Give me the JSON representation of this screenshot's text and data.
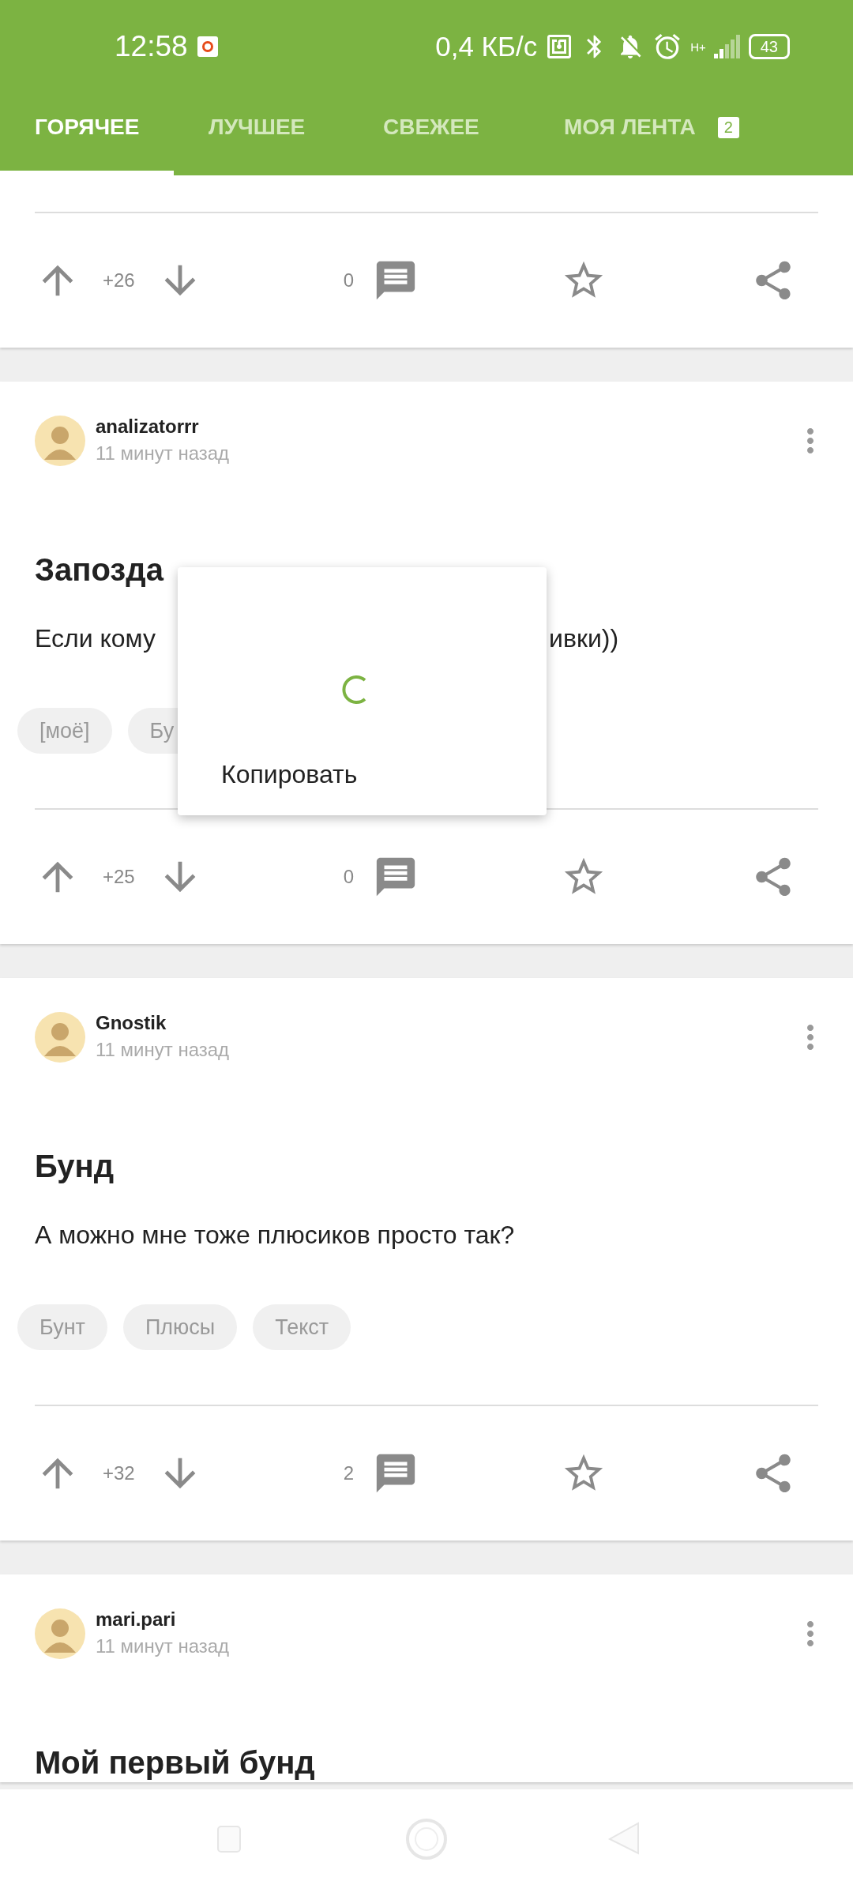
{
  "status_bar": {
    "time": "12:58",
    "speed": "0,4 КБ/с",
    "network": "H+",
    "battery": "43"
  },
  "tabs": [
    {
      "label": "ГОРЯЧЕЕ",
      "selected": true
    },
    {
      "label": "ЛУЧШЕЕ",
      "selected": false
    },
    {
      "label": "СВЕЖЕЕ",
      "selected": false
    },
    {
      "label": "МОЯ ЛЕНТА",
      "selected": false,
      "badge": "2"
    }
  ],
  "posts": [
    {
      "rating": "+26",
      "comments": "0"
    },
    {
      "author": "analizatorrr",
      "time": "11 минут назад",
      "title": "Запозда",
      "body_fragments": [
        "Если кому",
        "ивки))"
      ],
      "tags": [
        "[моё]",
        "Бу"
      ],
      "rating": "+25",
      "comments": "0"
    },
    {
      "author": "Gnostik",
      "time": "11 минут назад",
      "title": "Бунд",
      "body_fragments": [
        "А можно мне тоже плюсиков просто так?"
      ],
      "tags": [
        "Бунт",
        "Плюсы",
        "Текст"
      ],
      "rating": "+32",
      "comments": "2"
    },
    {
      "author": "mari.pari",
      "time": "11 минут назад",
      "title": "Мой первый бунд"
    }
  ],
  "popup": {
    "loading": true,
    "item": "Копировать"
  }
}
